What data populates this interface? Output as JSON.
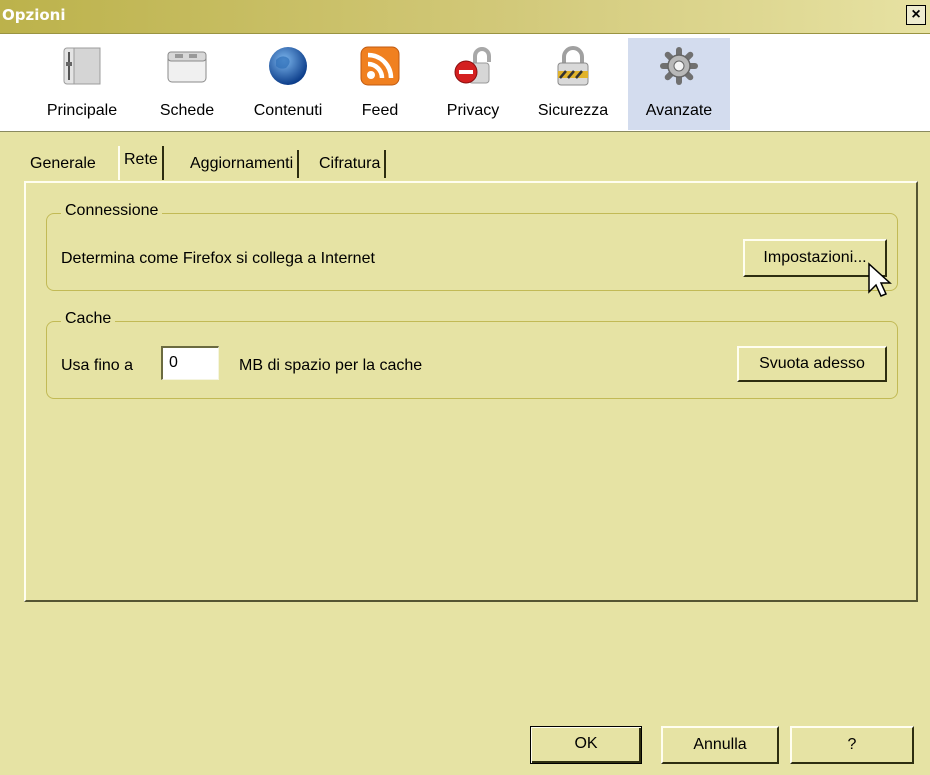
{
  "window": {
    "title": "Opzioni",
    "close_label": "×"
  },
  "toolbar": {
    "items": [
      {
        "label": "Principale",
        "icon": "main-settings-icon"
      },
      {
        "label": "Schede",
        "icon": "tabs-icon"
      },
      {
        "label": "Contenuti",
        "icon": "globe-icon"
      },
      {
        "label": "Feed",
        "icon": "rss-feed-icon"
      },
      {
        "label": "Privacy",
        "icon": "privacy-lock-icon"
      },
      {
        "label": "Sicurezza",
        "icon": "security-padlock-icon"
      },
      {
        "label": "Avanzate",
        "icon": "gear-icon"
      }
    ],
    "selected": "Avanzate"
  },
  "tabs": [
    {
      "label": "Generale"
    },
    {
      "label": "Rete"
    },
    {
      "label": "Aggiornamenti"
    },
    {
      "label": "Cifratura"
    }
  ],
  "active_tab": "Rete",
  "connection": {
    "legend": "Connessione",
    "description": "Determina come Firefox si collega a Internet",
    "button_label": "Impostazioni..."
  },
  "cache": {
    "legend": "Cache",
    "prefix": "Usa fino a",
    "value": "0",
    "suffix": "MB di spazio per la cache",
    "button_label": "Svuota adesso"
  },
  "footer": {
    "ok_label": "OK",
    "cancel_label": "Annulla",
    "help_label": "?"
  },
  "colors": {
    "window_bg": "#e6e3a4",
    "selected_toolbar_bg": "#d3dcee",
    "title_text": "#ffffff"
  }
}
